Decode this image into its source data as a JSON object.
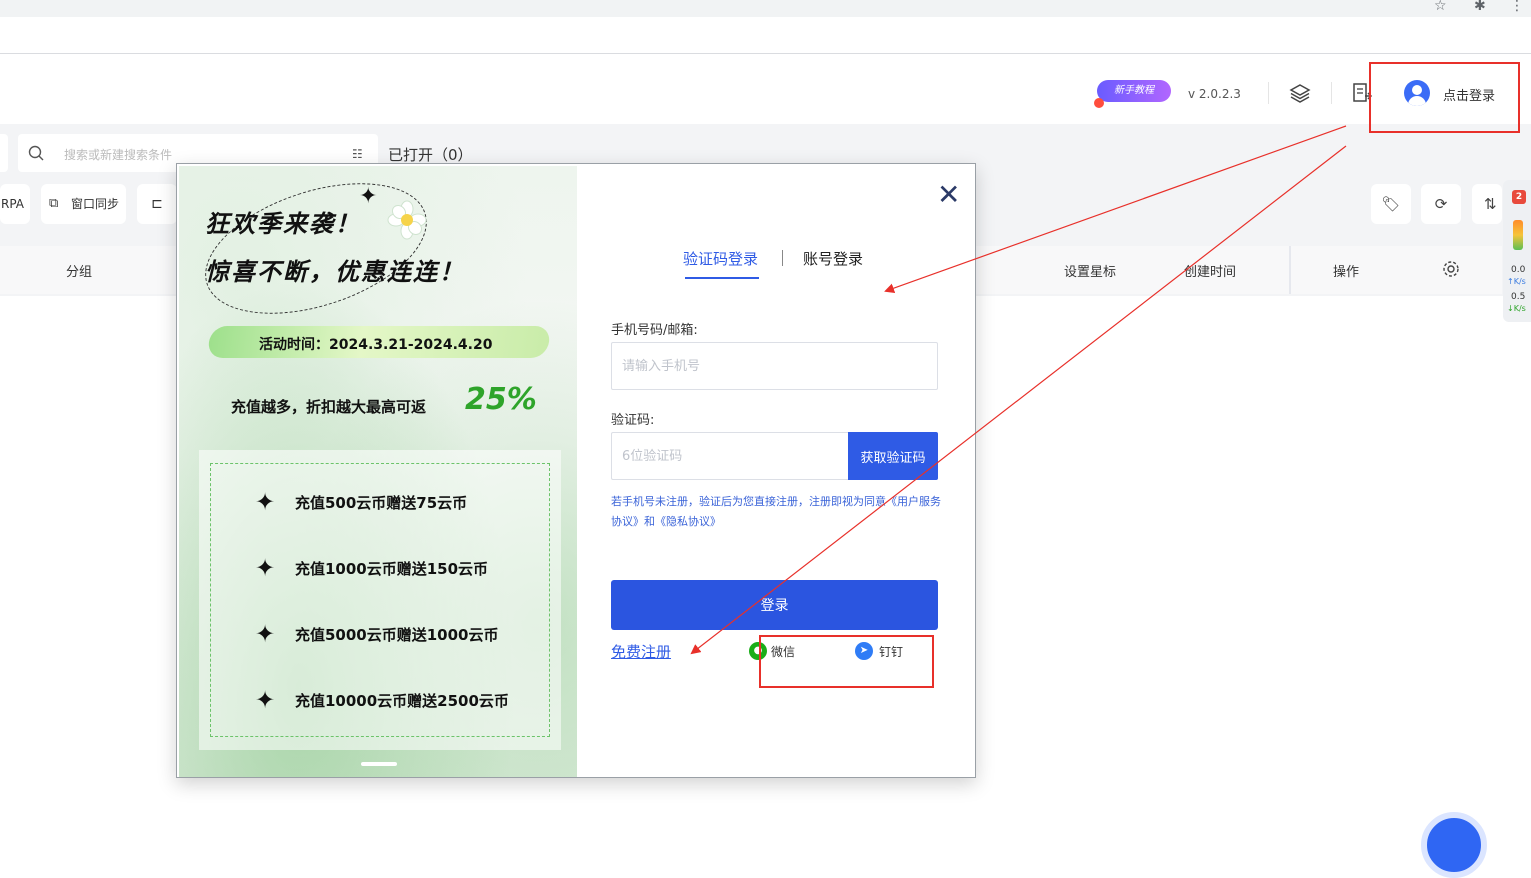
{
  "header": {
    "tutorial_badge": "新手教程",
    "version": "v 2.0.2.3",
    "login_link": "点击登录"
  },
  "toolbar": {
    "search_placeholder": "搜索或新建搜索条件",
    "opened_label": "已打开（0）",
    "rpa_label": "RPA",
    "sync_label": "窗口同步"
  },
  "table": {
    "columns": [
      "分组",
      "设置星标",
      "创建时间",
      "操作"
    ]
  },
  "side_panel": {
    "badge": "2",
    "up_speed": "0.0",
    "up_unit": "K/s",
    "down_speed": "0.5",
    "down_unit": "K/s"
  },
  "promo": {
    "title_line1": "狂欢季来袭！",
    "title_line2": "惊喜不断，优惠连连！",
    "date": "活动时间：2024.3.21-2024.4.20",
    "cashback_text": "充值越多，折扣越大最高可返",
    "cashback_pct": "25%",
    "offers": [
      "充值500云币赠送75云币",
      "充值1000云币赠送150云币",
      "充值5000云币赠送1000云币",
      "充值10000云币赠送2500云币"
    ]
  },
  "login": {
    "tab_code": "验证码登录",
    "tab_account": "账号登录",
    "phone_label": "手机号码/邮箱:",
    "phone_placeholder": "请输入手机号",
    "code_label": "验证码:",
    "code_placeholder": "6位验证码",
    "get_code": "获取验证码",
    "notice": "若手机号未注册，验证后为您直接注册，注册即视为同意《用户服务协议》和《隐私协议》",
    "login_button": "登录",
    "register": "免费注册",
    "wechat": "微信",
    "dingtalk": "钉钉"
  },
  "colors": {
    "primary": "#2f5be5",
    "annotation": "#e8302a",
    "promo_green": "#2ea42a"
  }
}
